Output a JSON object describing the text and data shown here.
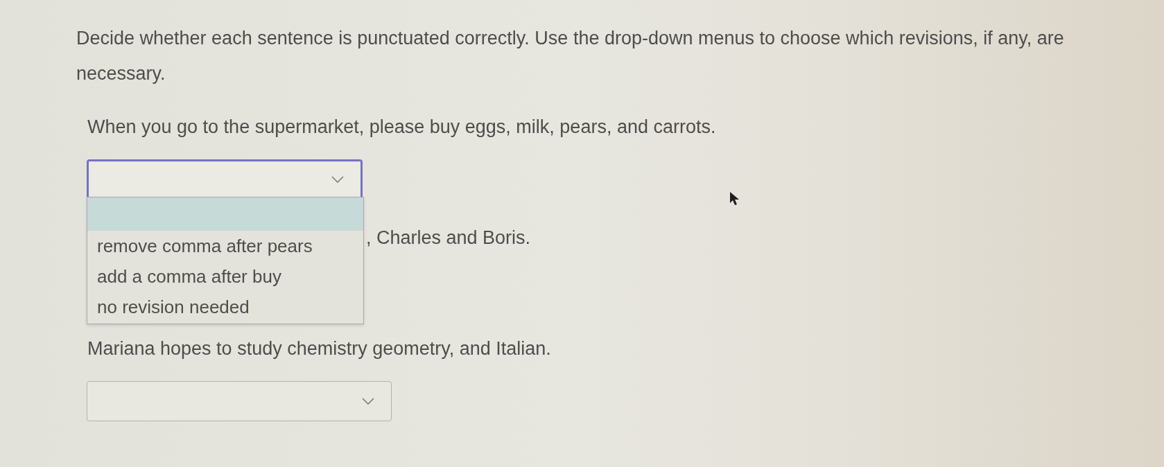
{
  "instructions": "Decide whether each sentence is punctuated correctly. Use the drop-down menus to choose which revisions, if any, are necessary.",
  "questions": [
    {
      "sentence": "When you go to the supermarket, please buy eggs, milk, pears, and carrots.",
      "dropdown": {
        "expanded": true,
        "options": [
          {
            "kind": "blank",
            "highlighted": true
          },
          {
            "kind": "text",
            "label": "remove comma after pears",
            "highlighted": false
          },
          {
            "kind": "text",
            "label": "add a comma after buy",
            "highlighted": false
          },
          {
            "kind": "text",
            "label": "no revision needed",
            "highlighted": false
          }
        ]
      }
    },
    {
      "sentence": ", Charles and Boris."
    },
    {
      "sentence": "Mariana hopes to study chemistry geometry, and Italian.",
      "dropdown": {
        "expanded": false
      }
    }
  ]
}
